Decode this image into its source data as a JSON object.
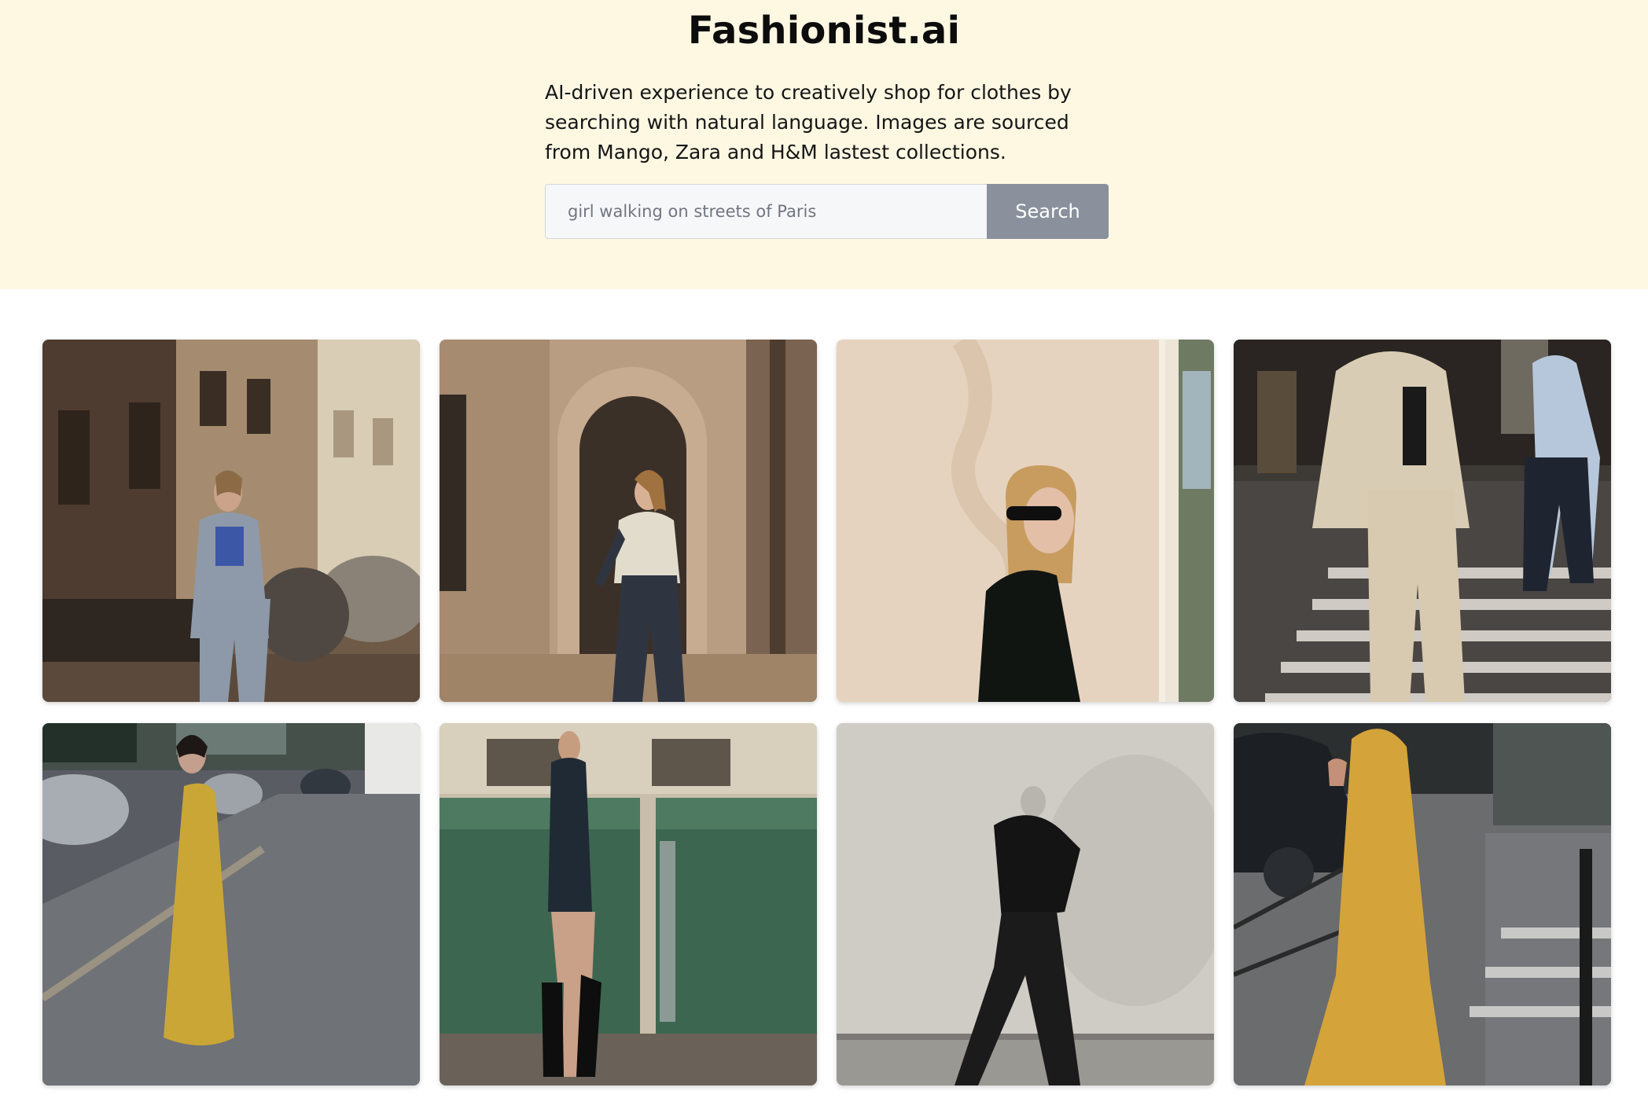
{
  "app": {
    "title": "Fashionist.ai",
    "description": "AI-driven experience to creatively shop for clothes by searching with natural language. Images are sourced from Mango, Zara and H&M lastest collections."
  },
  "search": {
    "placeholder": "girl walking on streets of Paris",
    "value": "",
    "button_label": "Search"
  },
  "results": [
    {
      "subject": "woman in grey suit and blue cropped top on a Paris street with parked cars"
    },
    {
      "subject": "woman in cream puffer vest and dark jeans walking past an arched doorway"
    },
    {
      "subject": "blonde woman with black sunglasses and black shirt against a stone wall"
    },
    {
      "subject": "woman in beige puffer jacket and beige trousers at a crosswalk"
    },
    {
      "subject": "woman in yellow satin one-shoulder dress on a sidewalk"
    },
    {
      "subject": "woman in dark sequin dress and black boots beside green bins"
    },
    {
      "subject": "black and white photo of woman in black puffer jacket walking"
    },
    {
      "subject": "woman in yellow satin slip dress near a crosswalk"
    }
  ],
  "colors": {
    "hero_background": "#fef8e3",
    "search_button": "#8a919d",
    "input_background": "#f6f7f9"
  }
}
